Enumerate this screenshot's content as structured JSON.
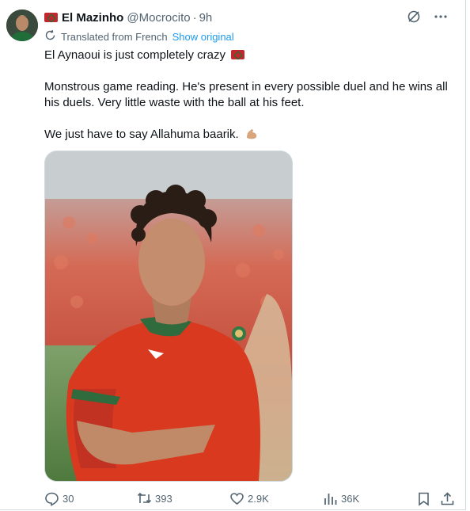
{
  "author": {
    "name": "El Mazinho",
    "handle": "@Mocrocito",
    "separator": "·",
    "time": "9h"
  },
  "translation": {
    "label": "Translated from French",
    "link": "Show original"
  },
  "post": {
    "line1": "El Aynaoui is just completely crazy",
    "line2": "Monstrous game reading. He's present in every possible duel and he wins all his duels. Very little waste with the ball at his feet.",
    "line3": "We just have to say Allahuma baarik."
  },
  "actions": {
    "replies": "30",
    "reposts": "393",
    "likes": "2.9K",
    "views": "36K"
  },
  "colors": {
    "accent": "#1d9bf0",
    "muted": "#536471",
    "flag_red": "#c1272d",
    "flag_green": "#0f7a3a",
    "jersey_red": "#d9391f"
  },
  "icons": [
    "flag-morocco-icon",
    "grok-icon",
    "more-icon",
    "translate-icon",
    "flexed-biceps-emoji",
    "reply-icon",
    "repost-icon",
    "like-icon",
    "views-icon",
    "bookmark-icon",
    "share-icon"
  ]
}
